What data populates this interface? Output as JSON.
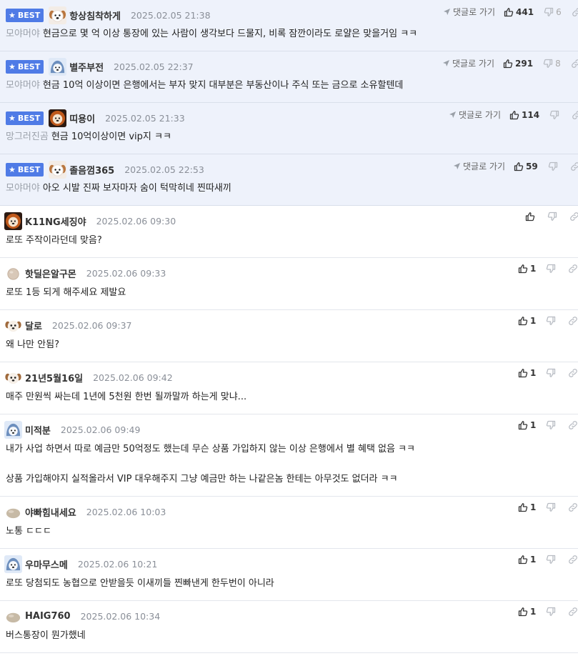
{
  "comments": [
    {
      "best": true,
      "badge": "BEST",
      "avatar": "dog",
      "nick": "항상침착하게",
      "date": "2025.02.05 21:38",
      "prefix": "모야머야",
      "text": "현금으로 몇 억 이상 통장에 있는 사람이 생각보다 드물지, 비록 잠깐이라도 로얄은 맞을거임 ㅋㅋ",
      "reply": "댓글로 가기",
      "up": "441",
      "down": "6"
    },
    {
      "best": true,
      "badge": "BEST",
      "avatar": "blue",
      "nick": "별주부전",
      "date": "2025.02.05 22:37",
      "prefix": "모야머야",
      "text": "현금 10억 이상이면 은행에서는 부자 맞지 대부분은 부동산이나 주식 또는 금으로 소유할텐데",
      "reply": "댓글로 가기",
      "up": "291",
      "down": "8"
    },
    {
      "best": true,
      "badge": "BEST",
      "avatar": "lion",
      "nick": "띠용이",
      "date": "2025.02.05 21:33",
      "prefix": "망그러진곰",
      "text": "현금 10억이상이면 vip지 ㅋㅋ",
      "reply": "댓글로 가기",
      "up": "114",
      "down": ""
    },
    {
      "best": true,
      "badge": "BEST",
      "avatar": "dog",
      "nick": "졸음껌365",
      "date": "2025.02.05 22:53",
      "prefix": "모야머야",
      "text": "아오 시발 진짜 보자마자 숨이 턱막히네 찐따새끼",
      "reply": "댓글로 가기",
      "up": "59",
      "down": ""
    },
    {
      "best": false,
      "avatar": "lion",
      "nick": "K11NG세징야",
      "date": "2025.02.06 09:30",
      "text": "로또 주작이라던데 맞음?",
      "up": "",
      "down": ""
    },
    {
      "best": false,
      "avatar": "ball",
      "nick": "핫딜은알구몬",
      "date": "2025.02.06 09:33",
      "text": "로또 1등 되게 해주세요 제발요",
      "up": "1",
      "down": ""
    },
    {
      "best": false,
      "avatar": "pup",
      "nick": "달로",
      "date": "2025.02.06 09:37",
      "text": "왜 나만 안됨?",
      "up": "1",
      "down": ""
    },
    {
      "best": false,
      "avatar": "pup",
      "nick": "21년5월16일",
      "date": "2025.02.06 09:42",
      "text": "매주 만원씩 싸는데 1년에 5천원 한번 될까말까 하는게 맞냐...",
      "up": "1",
      "down": ""
    },
    {
      "best": false,
      "avatar": "blue",
      "nick": "미적분",
      "date": "2025.02.06 09:49",
      "text": "내가 사업 하면서 따로 예금만 50억정도 했는데 무슨 상품 가입하지 않는 이상 은행에서 별 혜택 없음 ㅋㅋ",
      "text2": "상품 가입해야지 실적올라서 VIP 대우해주지 그냥 예금만 하는 나같은놈 한테는 아무것도 없더라 ㅋㅋ",
      "up": "1",
      "down": ""
    },
    {
      "best": false,
      "avatar": "egg",
      "nick": "야빠힘내세요",
      "date": "2025.02.06 10:03",
      "text": "노통 ㄷㄷㄷ",
      "up": "1",
      "down": ""
    },
    {
      "best": false,
      "avatar": "blue",
      "nick": "우마무스메",
      "date": "2025.02.06 10:21",
      "text": "로또 당첨되도 농협으로 안받을듯 이새끼들 찐빠낸게 한두번이 아니라",
      "up": "1",
      "down": ""
    },
    {
      "best": false,
      "avatar": "egg",
      "nick": "HAIG760",
      "date": "2025.02.06 10:34",
      "text": "버스통장이 뭔가했네",
      "up": "1",
      "down": ""
    }
  ]
}
